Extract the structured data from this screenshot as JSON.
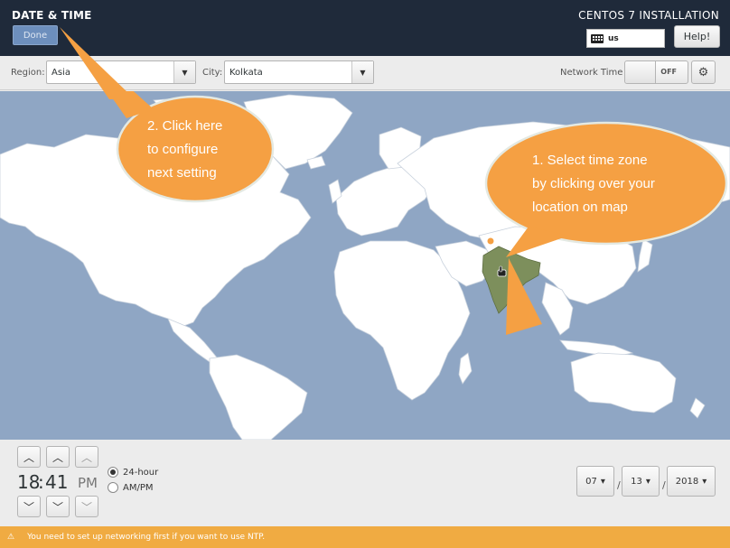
{
  "header": {
    "title": "DATE & TIME",
    "done_label": "Done",
    "install_title": "CENTOS 7 INSTALLATION",
    "keyboard_layout": "us",
    "help_label": "Help!"
  },
  "toolbar": {
    "region_label": "Region:",
    "region_value": "Asia",
    "city_label": "City:",
    "city_value": "Kolkata",
    "network_time_label": "Network Time",
    "ntp_state": "OFF"
  },
  "callouts": {
    "select_zone": [
      "1.  Select time zone",
      "by clicking over your",
      "location on map"
    ],
    "click_done": [
      "2. Click here",
      "to configure",
      "next setting"
    ]
  },
  "time": {
    "hours": "18",
    "minutes": "41",
    "ampm": "PM",
    "format_24": "24-hour",
    "format_12": "AM/PM",
    "selected_format": "24-hour"
  },
  "date": {
    "month": "07",
    "day": "13",
    "year": "2018",
    "separator": "/"
  },
  "status": {
    "warning": "You need to set up networking first if you want to use NTP."
  },
  "colors": {
    "header_bg": "#1f2a3a",
    "map_ocean": "#8fa6c4",
    "land": "#ffffff",
    "selected_region": "#7d8f5c",
    "callout": "#f5a043",
    "warning_bar": "#f0ab42"
  }
}
